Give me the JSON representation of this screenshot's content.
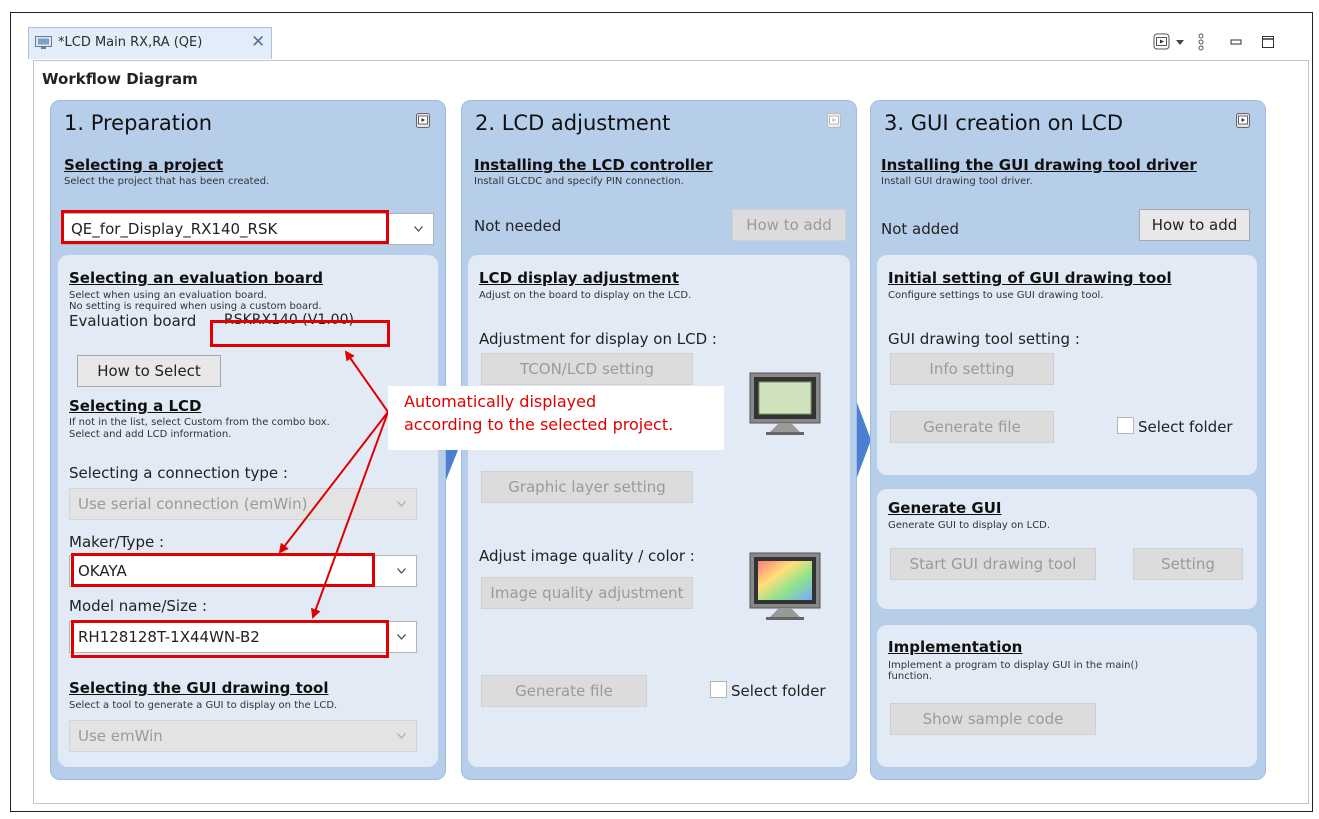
{
  "tab": {
    "title": "*LCD Main RX,RA (QE)",
    "close": "✕"
  },
  "workflow_label": "Workflow Diagram",
  "panel1": {
    "title": "1. Preparation",
    "project": {
      "heading": "Selecting a project",
      "desc": "Select the project that has been created.",
      "value": "QE_for_Display_RX140_RSK"
    },
    "board": {
      "heading": "Selecting an evaluation board",
      "desc1": "Select when using an evaluation board.",
      "desc2": "No setting is required when using a custom board.",
      "label": "Evaluation board",
      "value": "RSKRX140 (V1.00)",
      "button": "How to Select"
    },
    "lcd": {
      "heading": "Selecting a LCD",
      "desc1": "If not in the list, select Custom from the combo box.",
      "desc2": "Select and add LCD information.",
      "conn_label": "Selecting a connection type :",
      "conn_value": "Use serial connection (emWin)",
      "maker_label": "Maker/Type :",
      "maker_value": "OKAYA",
      "model_label": "Model name/Size :",
      "model_value": "RH128128T-1X44WN-B2"
    },
    "gui": {
      "heading": "Selecting the GUI drawing tool",
      "desc": "Select a tool to generate a GUI to display on the LCD.",
      "value": "Use emWin"
    }
  },
  "panel2": {
    "title": "2. LCD adjustment",
    "ctrl": {
      "heading": "Installing the LCD controller",
      "desc": "Install GLCDC and specify PIN connection.",
      "status": "Not needed",
      "button": "How to add"
    },
    "display": {
      "heading": "LCD display adjustment",
      "desc": "Adjust on the board to display on the LCD.",
      "label1": "Adjustment for display on LCD :",
      "btn_tcon": "TCON/LCD setting",
      "btn_layer": "Graphic layer setting",
      "label2": "Adjust image quality / color :",
      "btn_quality": "Image quality adjustment",
      "btn_generate": "Generate file",
      "chk_folder": "Select folder"
    }
  },
  "panel3": {
    "title": "3. GUI creation on LCD",
    "driver": {
      "heading": "Installing the GUI drawing tool driver",
      "desc": "Install GUI drawing tool driver.",
      "status": "Not added",
      "button": "How to add"
    },
    "initial": {
      "heading": "Initial setting of GUI drawing tool",
      "desc": "Configure settings to use GUI drawing tool.",
      "label": "GUI drawing tool setting :",
      "btn_info": "Info setting",
      "btn_generate": "Generate file",
      "chk_folder": "Select folder"
    },
    "generate": {
      "heading": "Generate GUI",
      "desc": "Generate GUI to display on LCD.",
      "btn_start": "Start GUI drawing tool",
      "btn_setting": "Setting"
    },
    "impl": {
      "heading": "Implementation",
      "desc1": "Implement a program to display GUI in the main()",
      "desc2": "function.",
      "button": "Show sample code"
    }
  },
  "callout": {
    "line1": "Automatically displayed",
    "line2": "according to the selected project."
  },
  "colors": {
    "panel": "#b7ceeb",
    "subbox": "#e2eaf6",
    "highlight": "#e00000",
    "arrow": "#4a7fd1"
  }
}
